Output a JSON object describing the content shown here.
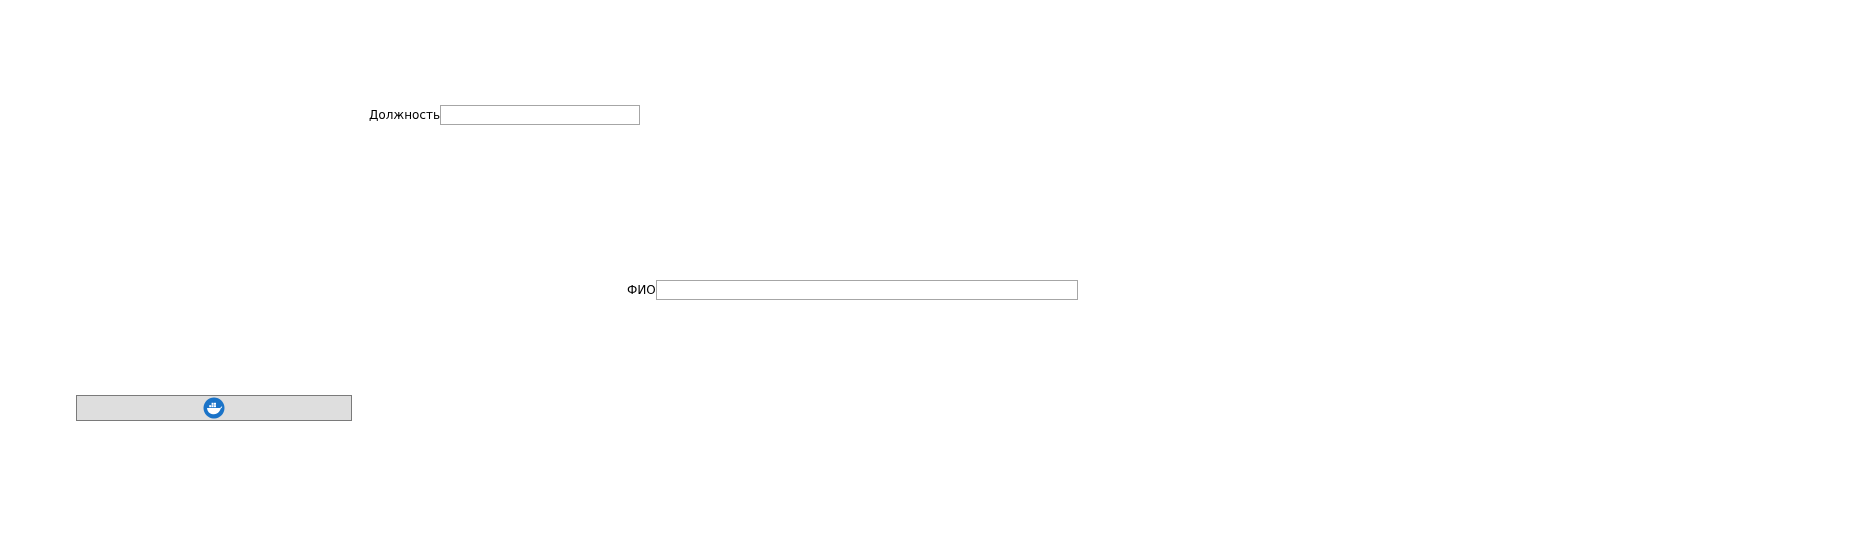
{
  "form": {
    "position": {
      "label": "Должность",
      "value": "",
      "placeholder": ""
    },
    "fio": {
      "label": "ФИО",
      "value": "",
      "placeholder": ""
    }
  },
  "action_button": {
    "icon": "docker-whale-icon",
    "icon_color": "#1a73c8"
  }
}
